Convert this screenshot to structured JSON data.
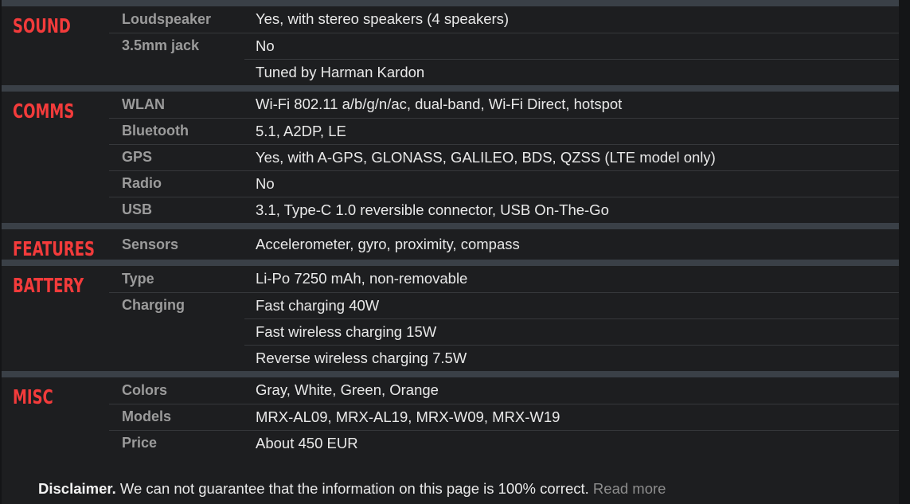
{
  "page": {
    "colors": {
      "background": "#1d1e20",
      "page_border": "#141517",
      "section_band": "#3a4047",
      "section_title": "#f33b3b",
      "label_text": "#9b9b9b",
      "value_text": "#e9e9e9",
      "row_separator": "#36383b",
      "link_text": "#8d8d8d"
    }
  },
  "sections": [
    {
      "title": "SOUND",
      "rows": [
        {
          "label": "Loudspeaker",
          "value": "Yes, with stereo speakers (4 speakers)"
        },
        {
          "label": "3.5mm jack",
          "value": "No"
        },
        {
          "label": "",
          "value": "Tuned by Harman Kardon"
        }
      ]
    },
    {
      "title": "COMMS",
      "rows": [
        {
          "label": "WLAN",
          "value": "Wi-Fi 802.11 a/b/g/n/ac, dual-band, Wi-Fi Direct, hotspot"
        },
        {
          "label": "Bluetooth",
          "value": "5.1, A2DP, LE"
        },
        {
          "label": "GPS",
          "value": "Yes, with A-GPS, GLONASS, GALILEO, BDS, QZSS (LTE model only)"
        },
        {
          "label": "Radio",
          "value": "No"
        },
        {
          "label": "USB",
          "value": "3.1, Type-C 1.0 reversible connector, USB On-The-Go"
        }
      ]
    },
    {
      "title": "FEATURES",
      "rows": [
        {
          "label": "Sensors",
          "value": "Accelerometer, gyro, proximity, compass"
        }
      ]
    },
    {
      "title": "BATTERY",
      "rows": [
        {
          "label": "Type",
          "value": "Li-Po 7250 mAh, non-removable"
        },
        {
          "label": "Charging",
          "value": "Fast charging 40W"
        },
        {
          "label": "",
          "value": "Fast wireless charging 15W"
        },
        {
          "label": "",
          "value": "Reverse wireless charging 7.5W"
        }
      ]
    },
    {
      "title": "MISC",
      "rows": [
        {
          "label": "Colors",
          "value": "Gray, White, Green, Orange"
        },
        {
          "label": "Models",
          "value": "MRX-AL09, MRX-AL19, MRX-W09, MRX-W19"
        },
        {
          "label": "Price",
          "value": "About 450 EUR"
        }
      ]
    }
  ],
  "footer": {
    "disclaimer_strong": "Disclaimer.",
    "disclaimer_text": " We can not guarantee that the information on this page is 100% correct. ",
    "read_more_label": "Read more"
  }
}
